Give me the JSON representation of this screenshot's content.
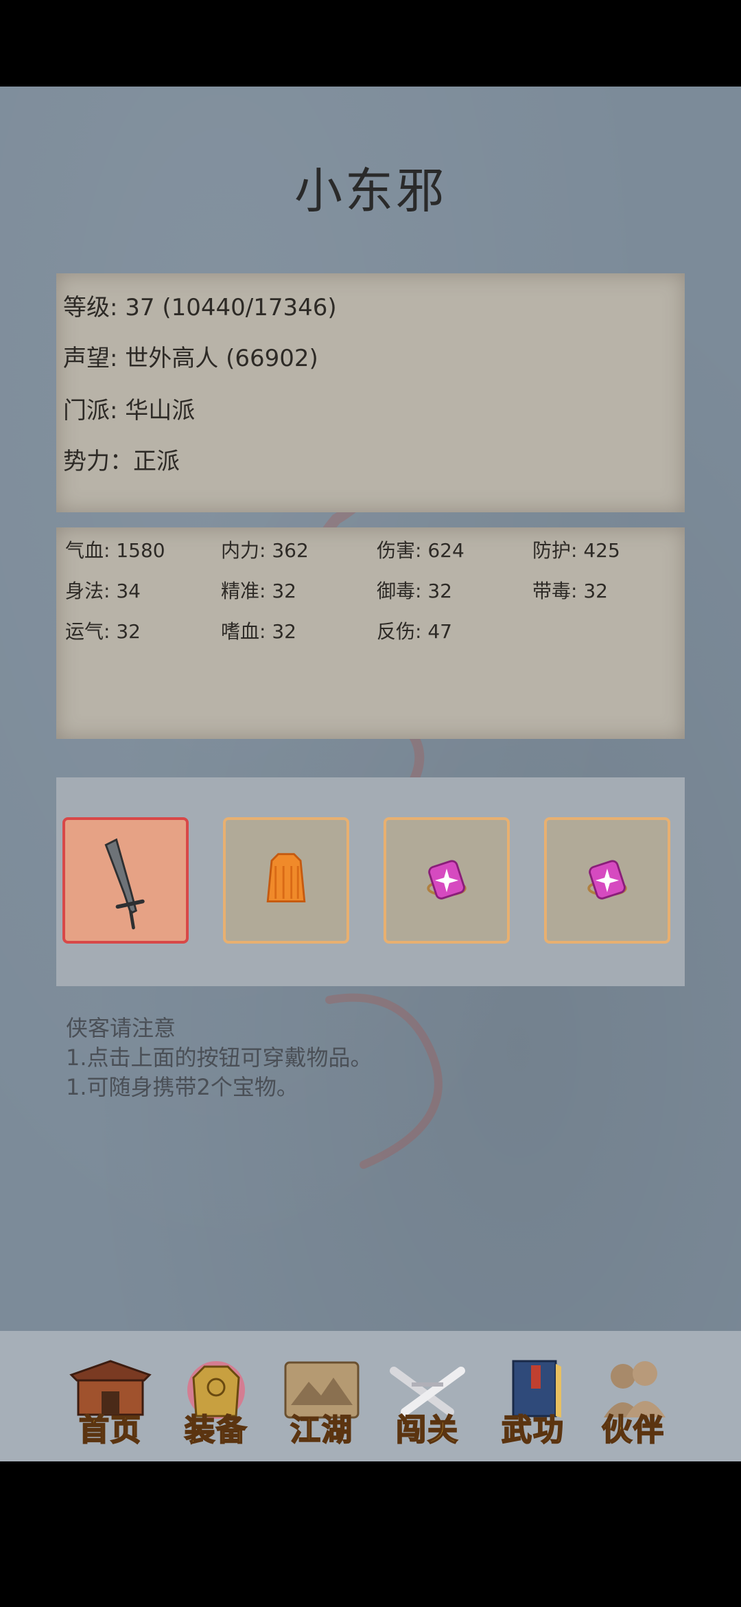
{
  "character": {
    "name": "小东邪"
  },
  "info": {
    "level": "等级: 37 (10440/17346)",
    "reputation": "声望: 世外高人 (66902)",
    "sect": "门派: 华山派",
    "faction": "势力：正派"
  },
  "stats": [
    "气血: 1580",
    "内力: 362",
    "伤害: 624",
    "防护: 425",
    "身法: 34",
    "精准: 32",
    "御毒: 32",
    "带毒: 32",
    "运气: 32",
    "嗜血: 32",
    "反伤: 47"
  ],
  "equipment_slots": [
    {
      "item": "sword-icon",
      "selected": true
    },
    {
      "item": "armor-icon",
      "selected": false
    },
    {
      "item": "treasure-icon",
      "selected": false
    },
    {
      "item": "treasure-icon",
      "selected": false
    }
  ],
  "notice": {
    "title": "侠客请注意",
    "line1": "1.点击上面的按钮可穿戴物品。",
    "line2": "1.可随身携带2个宝物。"
  },
  "nav": {
    "home": "首页",
    "equipment": "装备",
    "jianghu": "江湖",
    "stages": "闯关",
    "martial_arts": "武功",
    "partners": "伙伴"
  },
  "colors": {
    "background": "#7c8b99",
    "paper": "#b8b3a8",
    "selected_slot_border": "#d84848",
    "slot_border": "#e8b070",
    "nav_label": "#f3c23a"
  }
}
